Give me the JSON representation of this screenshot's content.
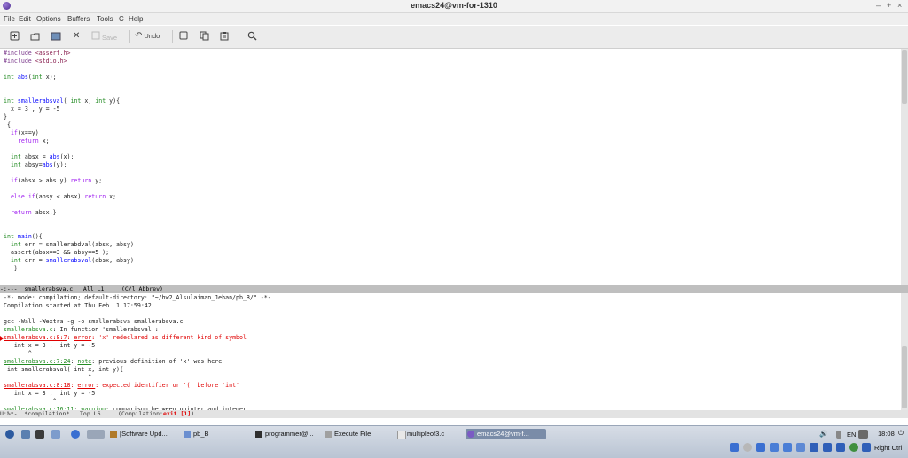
{
  "window": {
    "title": "emacs24@vm-for-1310",
    "controls": [
      "–",
      "+",
      "×"
    ]
  },
  "menu": [
    "File",
    "Edit",
    "Options",
    "Buffers",
    "Tools",
    "C",
    "Help"
  ],
  "toolbar": {
    "save_label": "Save",
    "undo_label": "Undo"
  },
  "code_lines": [
    "#include <assert.h>",
    "#include <stdio.h>",
    "",
    "int abs(int x);",
    "",
    "",
    "int smallerabsval( int x, int y){",
    "  x = 3 , y = -5",
    "}",
    " {",
    "  if(x==y)",
    "    return x;",
    "",
    "  int absx = abs(x);",
    "  int absy=abs(y);",
    "",
    "  if(absx > abs y) return y;",
    "",
    "  else if(absy < absx) return x;",
    "",
    "  return absx;}",
    "",
    "",
    "int main(){",
    "  int err = smallerabdval(absx, absy)",
    "  assert(absx==3 && absy==5 );",
    "  int err = smallerabsval(absx, absy)",
    "   }"
  ],
  "modeline1": "-:---  smallerabsva.c   All L1     (C/l Abbrev)",
  "compile_lines": [
    "-*- mode: compilation; default-directory: \"~/hw2_Alsulaiman_Jehan/pb_B/\" -*-",
    "Compilation started at Thu Feb  1 17:59:42",
    "",
    "gcc -Wall -Wextra -g -o smallerabsva smallerabsva.c",
    "smallerabsva.c: In function 'smallerabsval':",
    "smallerabsva.c:8:7: error: 'x' redeclared as different kind of symbol",
    "   int x = 3 ,  int y = -5",
    "       ^",
    "smallerabsva.c:7:24: note: previous definition of 'x' was here",
    " int smallerabsval( int x, int y){",
    "                        ^",
    "smallerabsva.c:8:18: error: expected identifier or '(' before 'int'",
    "   int x = 3 ,  int y = -5",
    "              ^",
    "smallerabsva.c:16:11: warning: comparison between pointer and integer"
  ],
  "modeline2": {
    "prefix": "U:%*-  *compilation*   Top L6     (Compilation:",
    "status": "exit [1]",
    "suffix": ")"
  },
  "taskbar": {
    "tasks": [
      "[Software Upd...",
      "pb_B",
      "programmer@...",
      "Execute File",
      "multipleof3.c",
      "emacs24@vm-f..."
    ],
    "lang": "EN",
    "clock": "18:08",
    "host_key": "Right Ctrl"
  },
  "colors": {
    "error": "#e00000",
    "keyword": "#a020f0",
    "type": "#228b22",
    "function": "#0000ff",
    "modeline": "#bfbfbf"
  }
}
